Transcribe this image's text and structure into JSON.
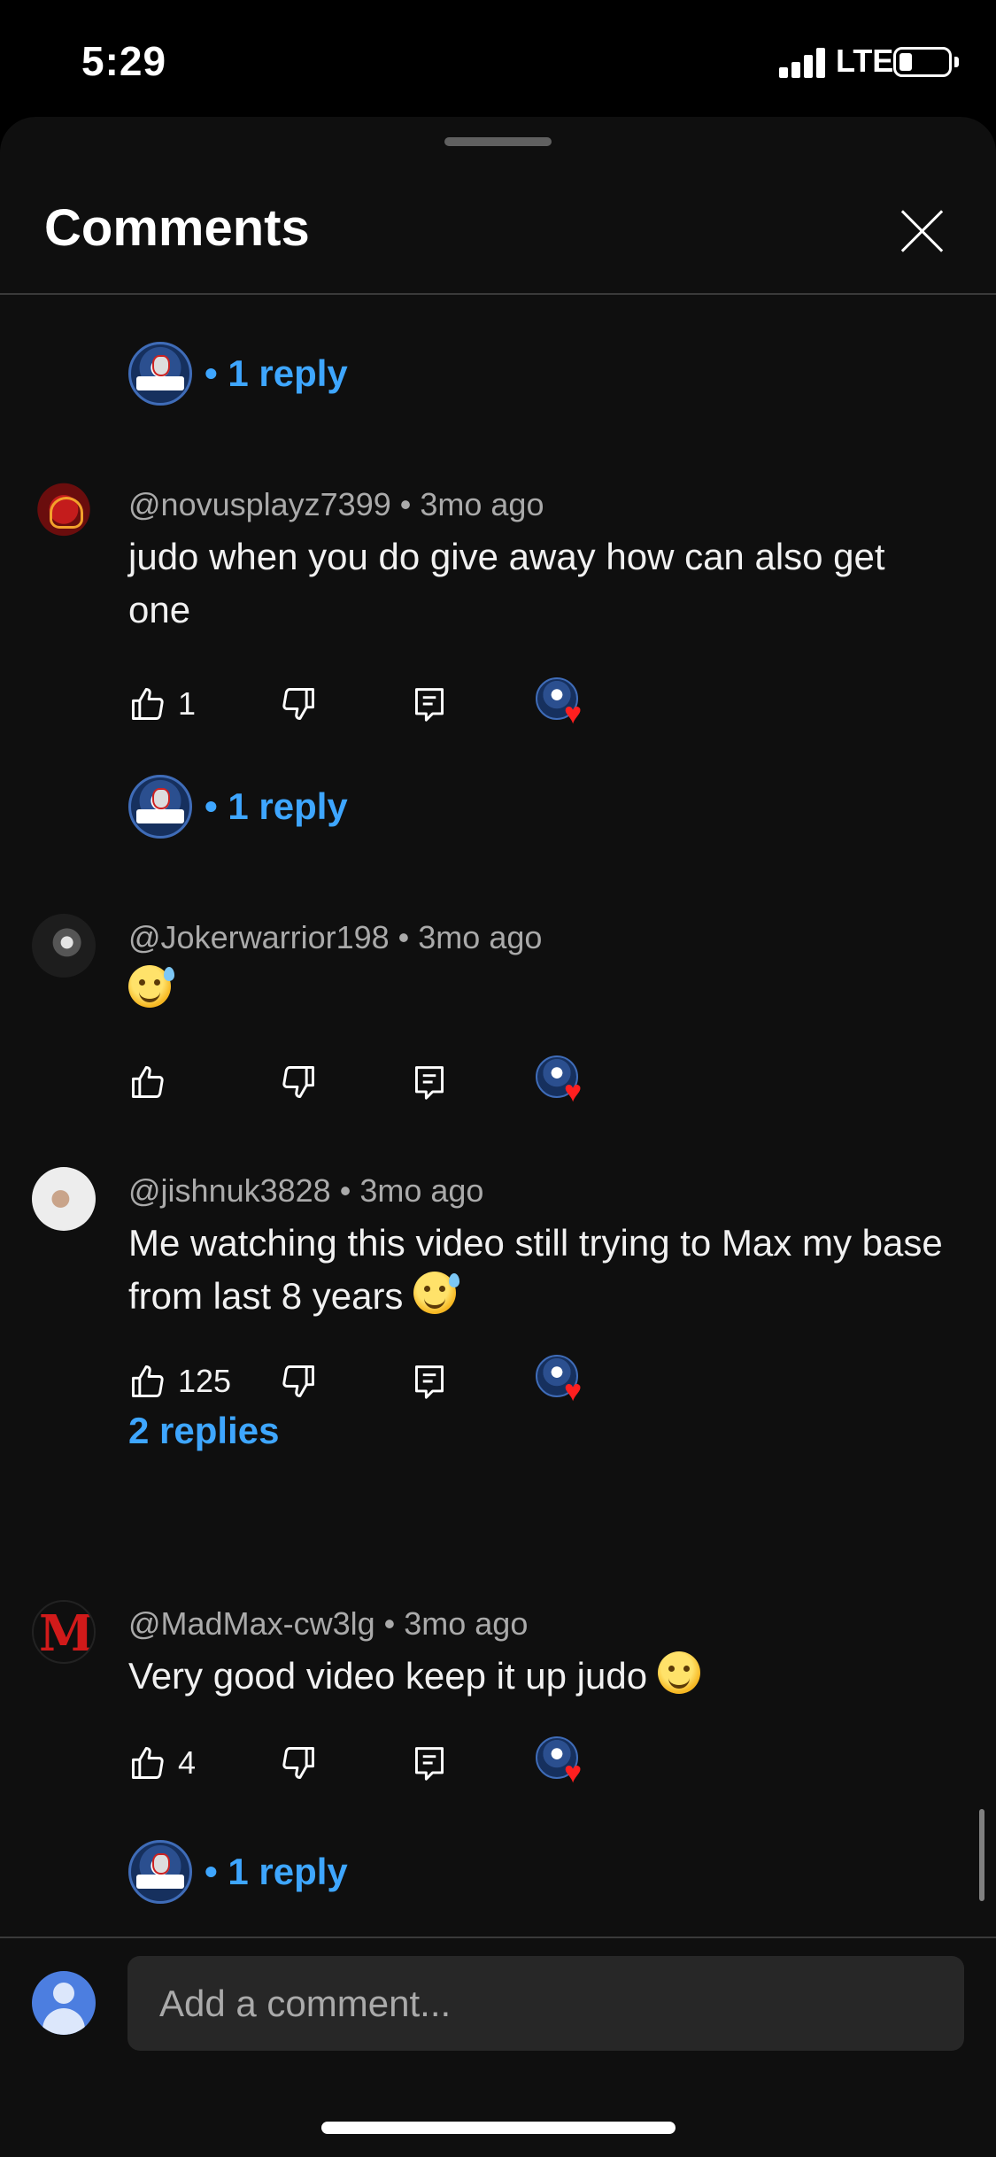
{
  "status_bar": {
    "time": "5:29",
    "network": "LTE"
  },
  "sheet": {
    "title": "Comments"
  },
  "threads": [
    {
      "replies_label": "• 1 reply"
    },
    {
      "author": "@novusplayz7399",
      "age": "3mo ago",
      "text": "judo when you do give away how can also get one",
      "likes": "1",
      "replies_label": "• 1 reply"
    },
    {
      "author": "@Jokerwarrior198",
      "age": "3mo ago",
      "text": "",
      "emoji": "sweat-smile-emoji",
      "likes": ""
    },
    {
      "author": "@jishnuk3828",
      "age": "3mo ago",
      "text": "Me watching this video still trying to Max my base from last 8 years",
      "emoji": "sweat-smile-emoji",
      "likes": "125",
      "replies_label": "2 replies"
    },
    {
      "author": "@MadMax-cw3lg",
      "age": "3mo ago",
      "text": "Very good video keep it up judo",
      "emoji": "smile-emoji",
      "likes": "4",
      "replies_label": "• 1 reply"
    }
  ],
  "input": {
    "placeholder": "Add a comment..."
  },
  "colors": {
    "accent": "#3ea6ff",
    "background": "#0f0f0f",
    "heart": "#ff1f1f"
  }
}
